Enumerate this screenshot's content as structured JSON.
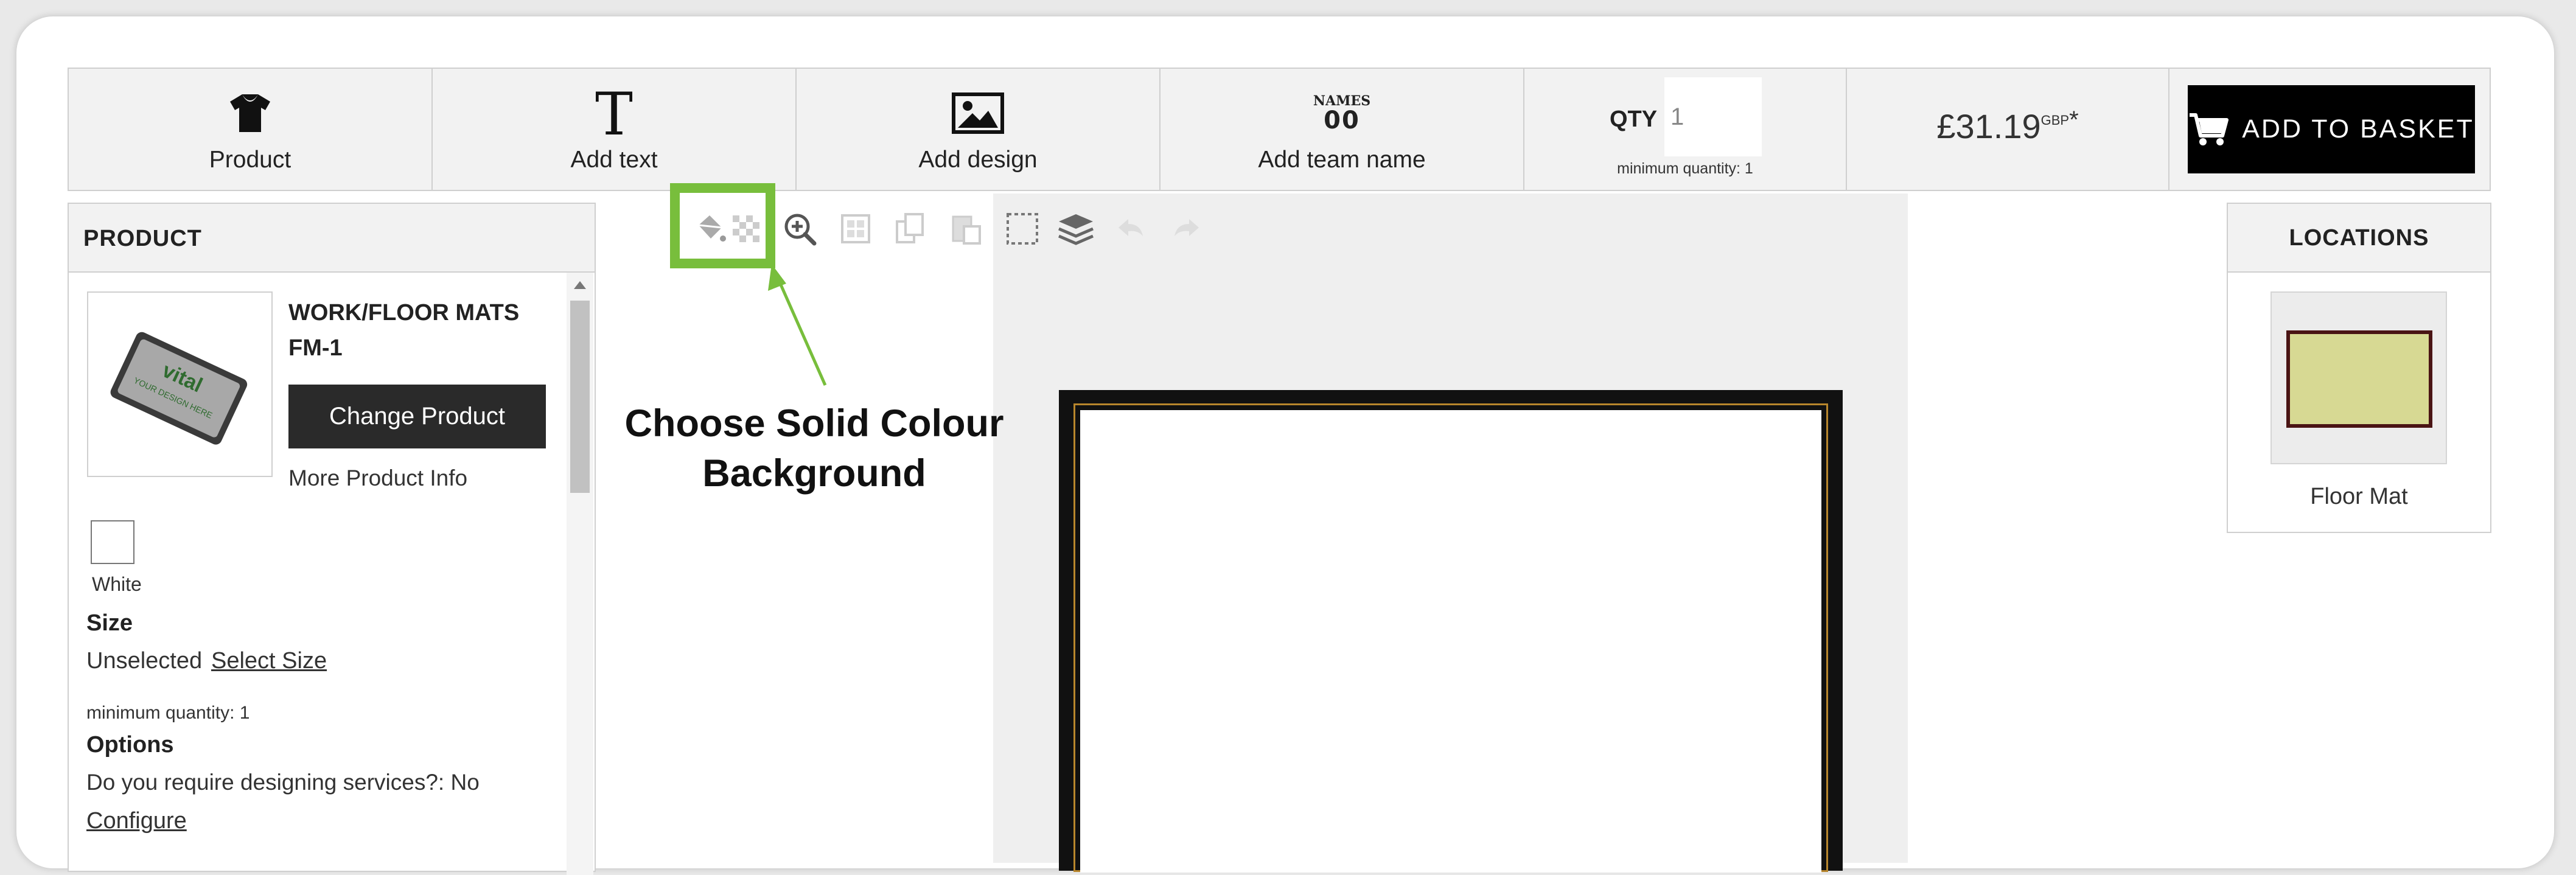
{
  "toolbar": {
    "tools": [
      {
        "label": "Product",
        "icon": "tshirt-icon"
      },
      {
        "label": "Add text",
        "icon": "text-icon"
      },
      {
        "label": "Add design",
        "icon": "image-icon"
      },
      {
        "label": "Add team name",
        "icon": "team-name-icon",
        "icon_text_top": "NAMES",
        "icon_text_bottom": "00"
      }
    ],
    "qty": {
      "label": "QTY",
      "value": "1",
      "note": "minimum quantity: 1"
    },
    "price": {
      "value": "£31.19",
      "currency": "GBP",
      "asterisk": "*"
    },
    "add_to_basket": "ADD TO BASKET"
  },
  "product_panel": {
    "header": "PRODUCT",
    "name": "WORK/FLOOR MATS FM-1",
    "thumb_text": {
      "brand": "vital",
      "tagline": "YOUR DESIGN HERE"
    },
    "change_button": "Change Product",
    "more_info": "More Product Info",
    "colour": {
      "label": "White",
      "swatch": "#ffffff"
    },
    "size": {
      "title": "Size",
      "value": "Unselected",
      "link": "Select Size"
    },
    "min_qty": "minimum quantity: 1",
    "options": {
      "title": "Options",
      "question": "Do you require designing services?: No",
      "link": "Configure"
    }
  },
  "canvas_tools": [
    "paint-bucket-icon",
    "transparent-background-icon",
    "zoom-in-icon",
    "grid-icon",
    "duplicate-icon",
    "paste-icon",
    "select-area-icon",
    "layers-icon",
    "undo-icon",
    "redo-icon"
  ],
  "annotation": {
    "line1": "Choose Solid Colour",
    "line2": "Background",
    "color": "#78be3c"
  },
  "locations": {
    "header": "LOCATIONS",
    "items": [
      {
        "label": "Floor Mat",
        "color": "#d7d993"
      }
    ]
  }
}
